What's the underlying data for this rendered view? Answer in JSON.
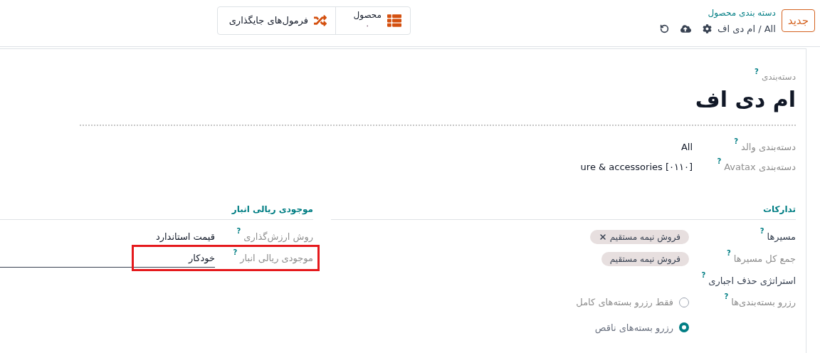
{
  "control_panel": {
    "new_button": "جدید",
    "title": "دسته بندی محصول",
    "path": [
      "All",
      "ام دی اف"
    ],
    "separator": "/"
  },
  "stat_buttons": [
    {
      "kind": "count",
      "label": "محصول",
      "value": "۰"
    },
    {
      "kind": "action",
      "label": "فرمول‌های جایگذاری"
    }
  ],
  "form": {
    "name_label": "دسته‌بندی",
    "name": "ام دی اف",
    "fields": [
      {
        "label": "دسته‌بندی والد",
        "value": "All"
      },
      {
        "label": "دسته‌بندی Avatax",
        "value": "ure & accessories [۰۱۱۰]"
      }
    ],
    "groups": [
      {
        "title": "تدارکات",
        "fields": [
          {
            "kind": "tags",
            "label": "مسیرها",
            "muted": false,
            "tags": [
              {
                "text": "فروش نیمه مستقیم",
                "removable": true
              }
            ]
          },
          {
            "kind": "tags",
            "label": "جمع کل مسیرها",
            "muted": true,
            "tags": [
              {
                "text": "فروش نیمه مستقیم",
                "removable": false
              }
            ]
          },
          {
            "kind": "empty",
            "label": "استراتژی حذف اجباری",
            "muted": false
          },
          {
            "kind": "radio",
            "label": "رزرو بسته‌بندی‌ها",
            "muted": true,
            "options": [
              {
                "text": "فقط رزرو بسته‌های کامل",
                "selected": false
              },
              {
                "text": "رزرو بسته‌های ناقص",
                "selected": true
              }
            ]
          }
        ]
      },
      {
        "title": "موجودی ریالی انبار",
        "fields": [
          {
            "kind": "text",
            "label": "روش ارزش‌گذاری",
            "muted": true,
            "value": "قیمت استاندارد",
            "editable": false,
            "highlighted": false
          },
          {
            "kind": "text",
            "label": "موجودی ریالی انبار",
            "muted": true,
            "value": "خودکار",
            "editable": true,
            "highlighted": true
          }
        ]
      }
    ]
  },
  "help_mark": "?"
}
